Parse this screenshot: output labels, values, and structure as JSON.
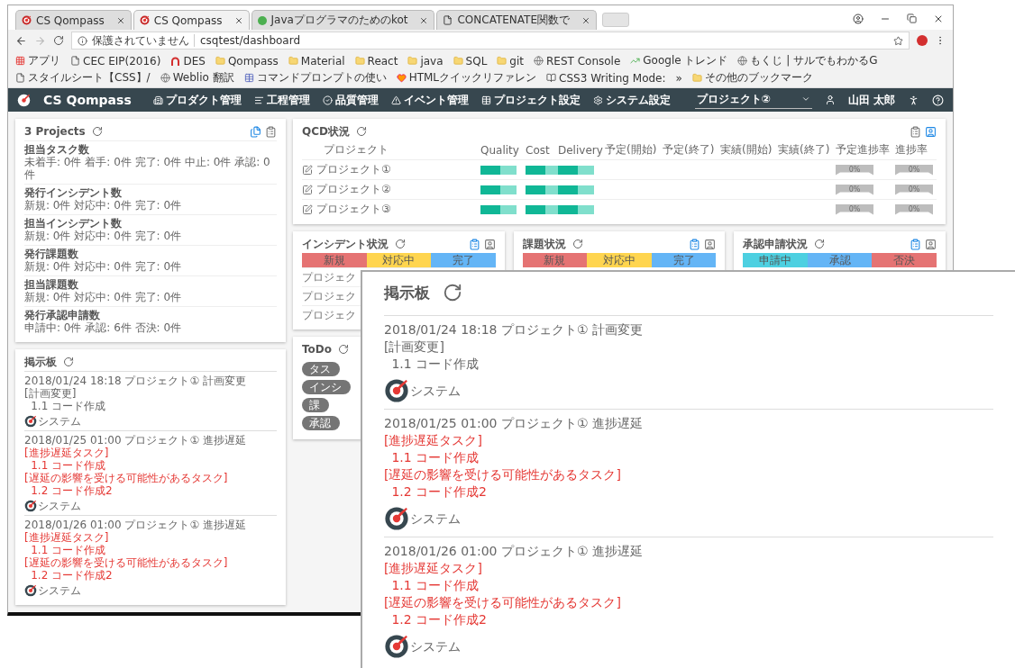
{
  "browser": {
    "tabs": [
      {
        "title": "CS Qompass",
        "kind": "logo",
        "selected": false
      },
      {
        "title": "CS Qompass",
        "kind": "logo",
        "selected": true
      },
      {
        "title": "Javaプログラマのためのkot",
        "kind": "dot",
        "selected": false
      },
      {
        "title": "CONCATENATE関数で",
        "kind": "page",
        "selected": false
      }
    ],
    "security": "保護されていません",
    "url": "csqtest/dashboard",
    "bookmarks": [
      {
        "label": "アプリ",
        "kind": "apps"
      },
      {
        "label": "CEC EIP(2016)",
        "kind": "page"
      },
      {
        "label": "DES",
        "kind": "arch"
      },
      {
        "label": "Qompass",
        "kind": "folder"
      },
      {
        "label": "Material",
        "kind": "folder"
      },
      {
        "label": "React",
        "kind": "folder"
      },
      {
        "label": "java",
        "kind": "folder"
      },
      {
        "label": "SQL",
        "kind": "folder"
      },
      {
        "label": "git",
        "kind": "folder"
      },
      {
        "label": "REST Console",
        "kind": "site"
      },
      {
        "label": "Google トレンド",
        "kind": "trend"
      },
      {
        "label": "もくじ | サルでもわかるG",
        "kind": "site"
      },
      {
        "label": "スタイルシート【CSS】/",
        "kind": "page"
      },
      {
        "label": "Weblio 翻訳",
        "kind": "site"
      },
      {
        "label": "コマンドプロンプトの使い",
        "kind": "table"
      },
      {
        "label": "HTMLクイックリファレン",
        "kind": "heart"
      },
      {
        "label": "CSS3 Writing Mode:",
        "kind": "book"
      }
    ],
    "overflow": "»",
    "other_bookmarks": "その他のブックマーク"
  },
  "app": {
    "brand": "CS Qompass",
    "menu": [
      {
        "label": "プロダクト管理",
        "kind": "building"
      },
      {
        "label": "工程管理",
        "kind": "list"
      },
      {
        "label": "品質管理",
        "kind": "check"
      },
      {
        "label": "イベント管理",
        "kind": "alert"
      },
      {
        "label": "プロジェクト設定",
        "kind": "table"
      },
      {
        "label": "システム設定",
        "kind": "gear"
      }
    ],
    "project_select": "プロジェクト②",
    "user": "山田 太郎"
  },
  "summary": {
    "title": "3 Projects",
    "tools": [
      {
        "kind": "files",
        "selected": true
      },
      {
        "kind": "clipboard",
        "selected": false
      }
    ],
    "items": [
      {
        "label": "担当タスク数",
        "detail": "未着手: 0件 着手: 0件 完了: 0件 中止: 0件 承認: 0件"
      },
      {
        "label": "発行インシデント数",
        "detail": "新規: 0件 対応中: 0件 完了: 0件"
      },
      {
        "label": "担当インシデント数",
        "detail": "新規: 0件 対応中: 0件 完了: 0件"
      },
      {
        "label": "発行課題数",
        "detail": "新規: 0件 対応中: 0件 完了: 0件"
      },
      {
        "label": "担当課題数",
        "detail": "新規: 0件 対応中: 0件 完了: 0件"
      },
      {
        "label": "発行承認申請数",
        "detail": "申請中: 0件 承認: 6件 否決: 0件"
      }
    ]
  },
  "bulletin": {
    "title": "掲示板",
    "entries": [
      {
        "kind": "normal",
        "datetime": "2018/01/24 18:18",
        "project": "プロジェクト①",
        "event": "計画変更",
        "lines": [
          {
            "text": "[計画変更]",
            "children": [
              {
                "text": "1.1 コード作成"
              }
            ]
          }
        ],
        "author": "システム"
      },
      {
        "kind": "alert",
        "datetime": "2018/01/25 01:00",
        "project": "プロジェクト①",
        "event": "進捗遅延",
        "lines": [
          {
            "text": "[進捗遅延タスク]",
            "children": [
              {
                "text": "1.1 コード作成"
              }
            ]
          },
          {
            "text": "[遅延の影響を受ける可能性があるタスク]",
            "children": [
              {
                "text": "1.2 コード作成2"
              }
            ]
          }
        ],
        "author": "システム"
      },
      {
        "kind": "alert",
        "datetime": "2018/01/26 01:00",
        "project": "プロジェクト①",
        "event": "進捗遅延",
        "lines": [
          {
            "text": "[進捗遅延タスク]",
            "children": [
              {
                "text": "1.1 コード作成"
              }
            ]
          },
          {
            "text": "[遅延の影響を受ける可能性があるタスク]",
            "children": [
              {
                "text": "1.2 コード作成2"
              }
            ]
          }
        ],
        "author": "システム"
      }
    ]
  },
  "qcd": {
    "title": "QCD状況",
    "tools": [
      {
        "kind": "clipboard",
        "selected": false
      },
      {
        "kind": "person",
        "selected": true
      }
    ],
    "columns": [
      "プロジェクト",
      "Quality",
      "Cost",
      "Delivery",
      "予定(開始)",
      "予定(終了)",
      "実績(開始)",
      "実績(終了)",
      "予定進捗率",
      "進捗率"
    ],
    "rows": [
      {
        "project": "プロジェクト①",
        "bars": [
          {
            "level": 0.55
          },
          {
            "level": 0.6
          },
          {
            "level": 0.55
          }
        ],
        "planned_progress": "0%",
        "progress": "0%"
      },
      {
        "project": "プロジェクト②",
        "bars": [
          {
            "level": 0.55
          },
          {
            "level": 0.6
          },
          {
            "level": 0.55
          }
        ],
        "planned_progress": "0%",
        "progress": "0%"
      },
      {
        "project": "プロジェクト③",
        "bars": [
          {
            "level": 0.55
          },
          {
            "level": 0.6
          },
          {
            "level": 0.55
          }
        ],
        "planned_progress": "0%",
        "progress": "0%"
      }
    ]
  },
  "status_cards": [
    {
      "title": "インシデント状況",
      "tools": [
        {
          "kind": "clipboard",
          "selected": true
        },
        {
          "kind": "person",
          "selected": false
        }
      ],
      "segments": [
        {
          "label": "新規",
          "color": "#e57373"
        },
        {
          "label": "対応中",
          "color": "#ffd54f"
        },
        {
          "label": "完了",
          "color": "#64b5f6"
        }
      ],
      "rows": [
        "プロジェク",
        "プロジェク",
        "プロジェク"
      ]
    },
    {
      "title": "課題状況",
      "tools": [
        {
          "kind": "clipboard",
          "selected": true
        },
        {
          "kind": "person",
          "selected": false
        }
      ],
      "segments": [
        {
          "label": "新規",
          "color": "#e57373"
        },
        {
          "label": "対応中",
          "color": "#ffd54f"
        },
        {
          "label": "完了",
          "color": "#64b5f6"
        }
      ]
    },
    {
      "title": "承認申請状況",
      "tools": [
        {
          "kind": "clipboard",
          "selected": true
        },
        {
          "kind": "person",
          "selected": false
        }
      ],
      "segments": [
        {
          "label": "申請中",
          "color": "#4dd0e1"
        },
        {
          "label": "承認",
          "color": "#64b5f6"
        },
        {
          "label": "否決",
          "color": "#e57373"
        }
      ]
    }
  ],
  "todo": {
    "title": "ToDo",
    "items": [
      "タス",
      "インシ",
      "課",
      "承認"
    ]
  },
  "zoom_panel": {
    "title": "掲示板",
    "entries": [
      {
        "kind": "normal",
        "datetime": "2018/01/24 18:18",
        "project": "プロジェクト①",
        "event": "計画変更",
        "lines": [
          {
            "text": "[計画変更]",
            "children": [
              {
                "text": "1.1 コード作成"
              }
            ]
          }
        ],
        "author": "システム"
      },
      {
        "kind": "alert",
        "datetime": "2018/01/25 01:00",
        "project": "プロジェクト①",
        "event": "進捗遅延",
        "lines": [
          {
            "text": "[進捗遅延タスク]",
            "children": [
              {
                "text": "1.1 コード作成"
              }
            ]
          },
          {
            "text": "[遅延の影響を受ける可能性があるタスク]",
            "children": [
              {
                "text": "1.2 コード作成2"
              }
            ]
          }
        ],
        "author": "システム"
      },
      {
        "kind": "alert",
        "datetime": "2018/01/26 01:00",
        "project": "プロジェクト①",
        "event": "進捗遅延",
        "lines": [
          {
            "text": "[進捗遅延タスク]",
            "children": [
              {
                "text": "1.1 コード作成"
              }
            ]
          },
          {
            "text": "[遅延の影響を受ける可能性があるタスク]",
            "children": [
              {
                "text": "1.2 コード作成2"
              }
            ]
          }
        ],
        "author": "システム"
      }
    ]
  }
}
